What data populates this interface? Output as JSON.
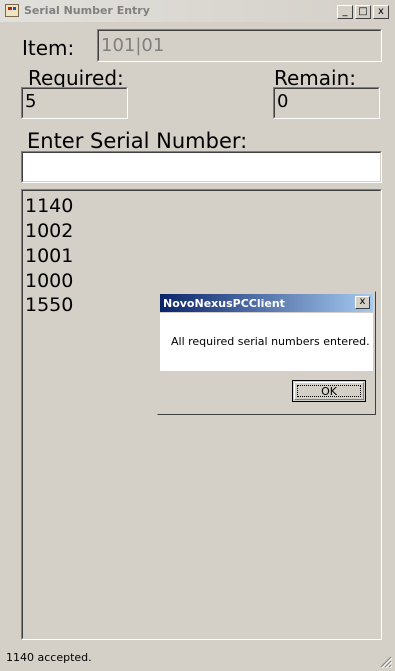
{
  "window": {
    "title": "Serial Number Entry",
    "buttons": {
      "minimize": "_",
      "maximize": "□",
      "close": "x"
    }
  },
  "item": {
    "label": "Item:",
    "value": "101|01"
  },
  "required": {
    "label": "Required:",
    "value": "5"
  },
  "remain": {
    "label": "Remain:",
    "value": "0"
  },
  "serial": {
    "label": "Enter Serial Number:",
    "value": ""
  },
  "serial_list": [
    "1140",
    "1002",
    "1001",
    "1000",
    "1550"
  ],
  "status_bar": {
    "text": "1140 accepted."
  },
  "dialog": {
    "title": "NovoNexusPCClient",
    "close": "x",
    "message": "All required serial numbers entered.",
    "ok_label": "OK"
  },
  "colors": {
    "face": "#d4d0c8",
    "dialog_title_start": "#0a246a",
    "dialog_title_end": "#a6caf0"
  }
}
